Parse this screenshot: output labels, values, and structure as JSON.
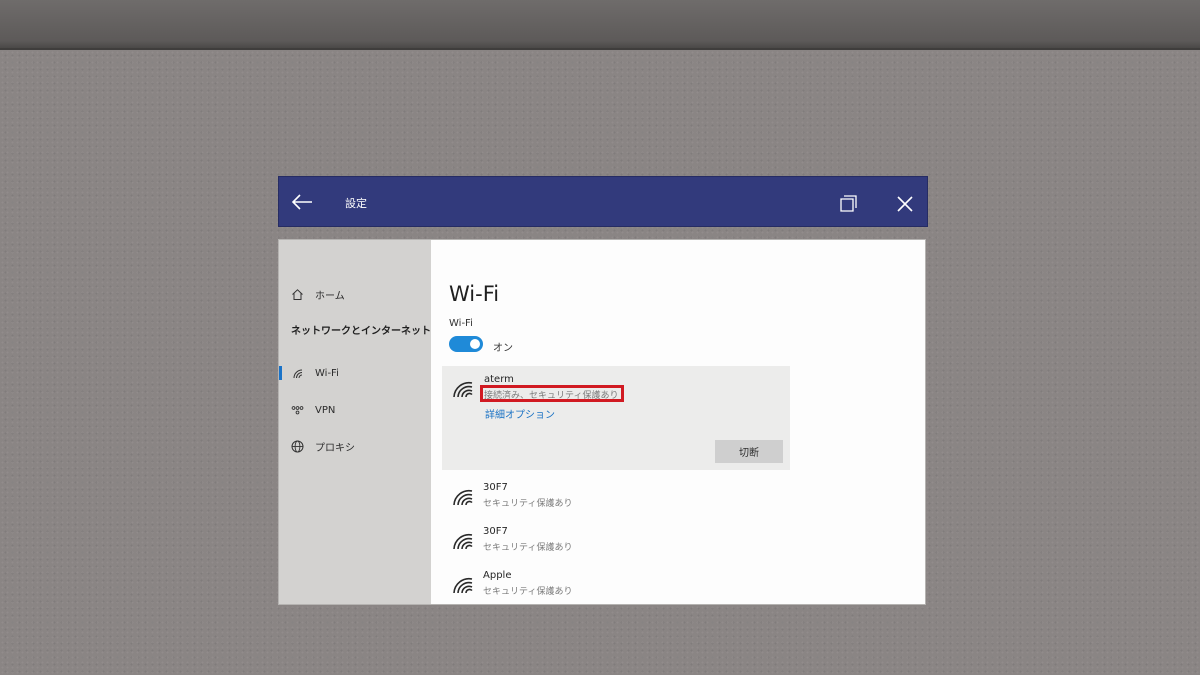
{
  "titlebar": {
    "title": "設定",
    "icons": {
      "back": "arrow-left-icon",
      "restore": "restore-window-icon",
      "close": "close-icon"
    }
  },
  "sidebar": {
    "home_label": "ホーム",
    "section_header": "ネットワークとインターネット",
    "items": [
      {
        "label": "Wi-Fi",
        "icon": "wifi-icon",
        "active": true
      },
      {
        "label": "VPN",
        "icon": "vpn-icon",
        "active": false
      },
      {
        "label": "プロキシ",
        "icon": "globe-icon",
        "active": false
      }
    ]
  },
  "main": {
    "title": "Wi-Fi",
    "wifi_label": "Wi-Fi",
    "toggle_state": "オン",
    "connected_network": {
      "name": "aterm",
      "status": "接続済み、セキュリティ保護あり",
      "advanced_link": "詳細オプション",
      "disconnect_label": "切断"
    },
    "networks": [
      {
        "name": "30F7",
        "status": "セキュリティ保護あり"
      },
      {
        "name": "30F7",
        "status": "セキュリティ保護あり"
      },
      {
        "name": "Apple",
        "status": "セキュリティ保護あり"
      }
    ]
  },
  "colors": {
    "titlebar": "#323a7c",
    "accent": "#1f8ad8",
    "highlight": "#d11a22",
    "link": "#1a72c4"
  }
}
